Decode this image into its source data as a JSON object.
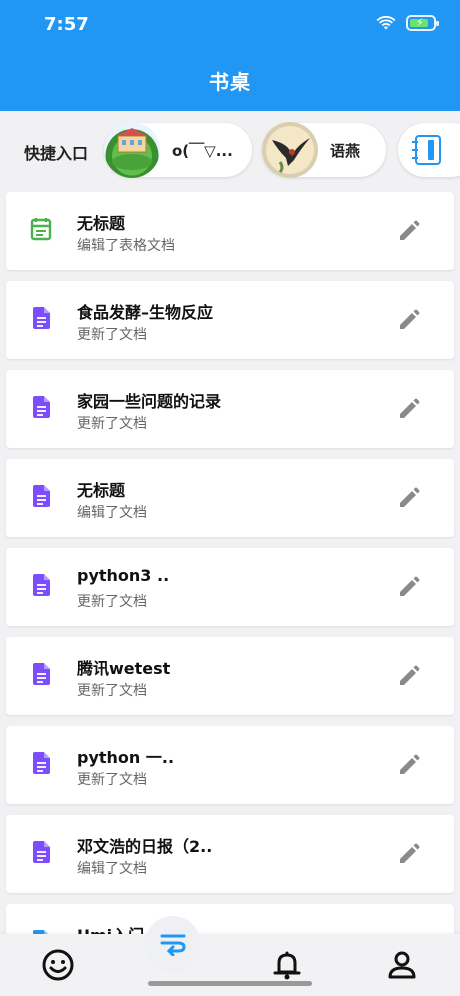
{
  "status": {
    "time": "7:57"
  },
  "header": {
    "title": "书桌"
  },
  "quick": {
    "label": "快捷入口",
    "items": [
      {
        "name": "o(￣▽..."
      },
      {
        "name": "语燕"
      },
      {
        "name": ""
      }
    ]
  },
  "documents": [
    {
      "title": "无标题",
      "subtitle": "编辑了表格文档",
      "icon": "spreadsheet-icon",
      "color": "#4caf50"
    },
    {
      "title": "食品发酵–生物反应",
      "subtitle": "更新了文档",
      "icon": "document-icon",
      "color": "#7c4dff"
    },
    {
      "title": "家园一些问题的记录",
      "subtitle": "更新了文档",
      "icon": "document-icon",
      "color": "#7c4dff"
    },
    {
      "title": "无标题",
      "subtitle": "编辑了文档",
      "icon": "document-icon",
      "color": "#7c4dff"
    },
    {
      "title": "python3 ..",
      "subtitle": "更新了文档",
      "icon": "document-icon",
      "color": "#7c4dff"
    },
    {
      "title": "腾讯wetest",
      "subtitle": "更新了文档",
      "icon": "document-icon",
      "color": "#7c4dff"
    },
    {
      "title": "python 一..",
      "subtitle": "更新了文档",
      "icon": "document-icon",
      "color": "#7c4dff"
    },
    {
      "title": "邓文浩的日报（2..",
      "subtitle": "编辑了文档",
      "icon": "document-icon",
      "color": "#7c4dff"
    },
    {
      "title": "Umi入门",
      "subtitle": "",
      "icon": "document-icon",
      "color": "#2196f3"
    }
  ],
  "nav": {
    "items": [
      "smile-icon",
      "switch-icon",
      "bell-icon",
      "profile-icon"
    ]
  },
  "colors": {
    "accent": "#2196f3",
    "doc": "#7c4dff",
    "sheet": "#4caf50",
    "edit": "#8a8a8a"
  }
}
